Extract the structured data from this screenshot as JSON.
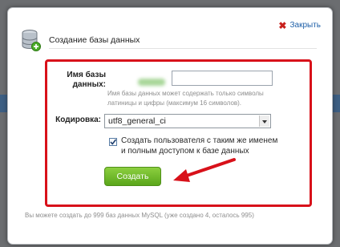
{
  "header": {
    "title": "Создание базы данных",
    "close_label": "Закрыть"
  },
  "form": {
    "name_label_line1": "Имя базы",
    "name_label_line2": "данных:",
    "name_value": "",
    "name_hint": "Имя базы данных может содержать только символы латиницы и цифры (максимум 16 символов).",
    "encoding_label": "Кодировка:",
    "encoding_value": "utf8_general_ci",
    "create_user_label": "Создать пользователя с таким же именем и полным доступом к базе данных",
    "create_user_checked": true,
    "create_button": "Создать"
  },
  "footer": {
    "info": "Вы можете создать до 999 баз данных MySQL (уже создано 4, осталось 995)"
  },
  "colors": {
    "highlight_box": "#d8111a",
    "button_green": "#6cb72a",
    "link_blue": "#1d5fa8"
  },
  "icons": {
    "title_icon": "database-add-icon",
    "close_icon": "close-x-icon",
    "select_icon": "dropdown-arrow-icon",
    "check_icon": "checkmark-icon",
    "annotation": "red-arrow-icon"
  }
}
